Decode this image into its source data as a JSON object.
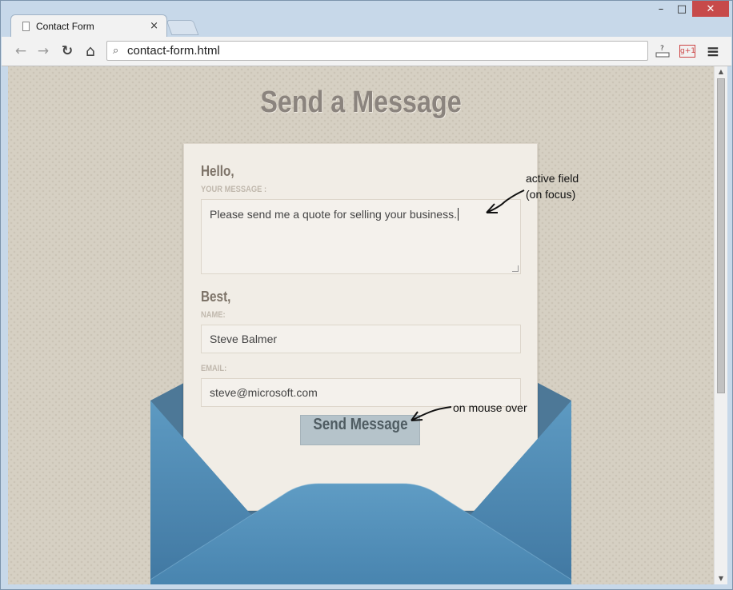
{
  "browser": {
    "tab_title": "Contact Form",
    "address": "contact-form.html",
    "window_controls": [
      "minimize-icon",
      "maximize-icon",
      "close-icon"
    ],
    "window_control_glyphs": {
      "minimize": "–",
      "maximize": "□",
      "close": "✕"
    },
    "tab_close_glyph": "×",
    "nav": {
      "back_glyph": "←",
      "forward_glyph": "→",
      "reload_glyph": "↻",
      "home_glyph": "⌂",
      "search_glyph": "⌕"
    },
    "extension_badge": "g+1",
    "help_glyph": "?",
    "menu_glyph": "≡"
  },
  "page": {
    "heading": "Send a Message",
    "form": {
      "hello_label": "Hello,",
      "message_label": "YOUR MESSAGE :",
      "message_value": "Please send me a quote for selling your business.",
      "best_label": "Best,",
      "name_label": "NAME:",
      "name_value": "Steve Balmer",
      "email_label": "EMAIL:",
      "email_value": "steve@microsoft.com",
      "submit_label": "Send Message"
    },
    "annotations": {
      "active_field_line1": "active field",
      "active_field_line2": "(on focus)",
      "hover": "on mouse over"
    }
  },
  "colors": {
    "background": "#d6d0c3",
    "heading": "#8b847e",
    "envelope": "#4a83aa",
    "button": "#b5c3ca",
    "close_button": "#c74a4a"
  }
}
